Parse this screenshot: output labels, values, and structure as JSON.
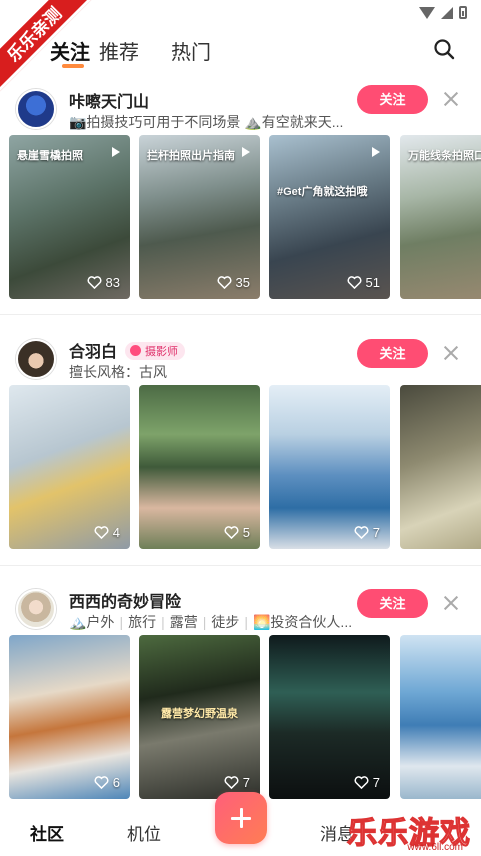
{
  "ribbon": {
    "text": "乐乐亲测"
  },
  "topnav": {
    "tabs": [
      {
        "label": "关注",
        "active": true
      },
      {
        "label": "推荐",
        "active": false
      },
      {
        "label": "热门",
        "active": false
      }
    ]
  },
  "colors": {
    "accent": "#ff4d73",
    "tab_underline": "#ff8a3d"
  },
  "feed": [
    {
      "name": "咔嚓天门山",
      "subtitle": "📷拍摄技巧可用于不同场景 ⛰️有空就来天...",
      "follow_label": "关注",
      "thumbs": [
        {
          "caption": "悬崖雪橇拍照",
          "video": true,
          "likes": "83"
        },
        {
          "caption": "拦杆拍照出片指南",
          "video": true,
          "likes": "35"
        },
        {
          "caption": "#Get广角就这拍哦",
          "video": true,
          "likes": "51"
        },
        {
          "caption": "万能线条拍照口",
          "video": false,
          "likes": ""
        }
      ]
    },
    {
      "name": "合羽白",
      "badge": "摄影师",
      "subtitle": "擅长风格：古风",
      "follow_label": "关注",
      "thumbs": [
        {
          "caption": "",
          "video": false,
          "likes": "4"
        },
        {
          "caption": "",
          "video": false,
          "likes": "5"
        },
        {
          "caption": "",
          "video": false,
          "likes": "7"
        },
        {
          "caption": "",
          "video": false,
          "likes": ""
        }
      ]
    },
    {
      "name": "西西的奇妙冒险",
      "subtitle_tags": [
        "🏔️户外",
        "旅行",
        "露营",
        "徒步",
        "🌅投资合伙人..."
      ],
      "follow_label": "关注",
      "thumbs": [
        {
          "caption": "",
          "video": false,
          "likes": "6"
        },
        {
          "caption": "露营梦幻野温泉",
          "video": false,
          "likes": "7"
        },
        {
          "caption": "",
          "video": false,
          "likes": "7"
        },
        {
          "caption": "",
          "video": false,
          "likes": ""
        }
      ]
    }
  ],
  "bottom_nav": {
    "items": [
      {
        "label": "社区",
        "active": true
      },
      {
        "label": "机位",
        "active": false
      },
      {
        "label": "消息",
        "active": false
      }
    ],
    "fab_icon": "plus-icon"
  },
  "watermark": {
    "text": "乐乐游戏",
    "url": "www.6ll.com"
  }
}
